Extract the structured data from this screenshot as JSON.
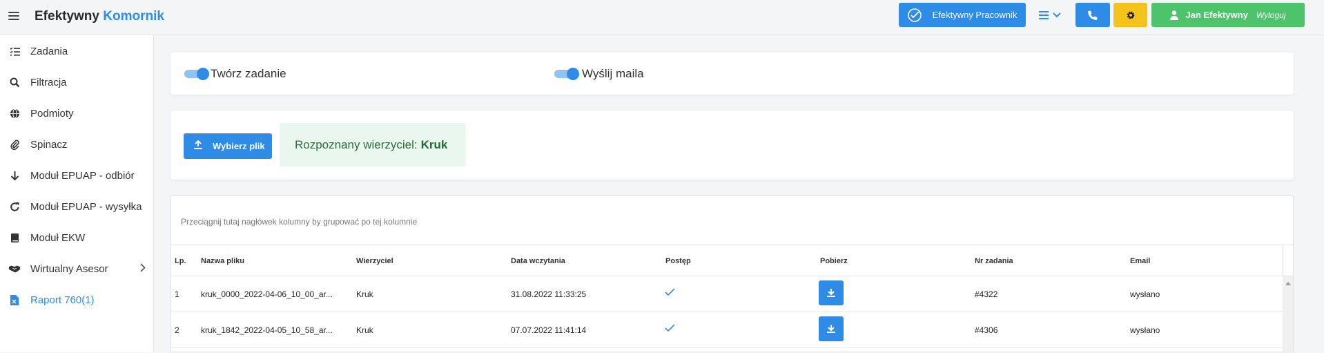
{
  "brand": {
    "part1": "Efektywny",
    "part2": "Komornik"
  },
  "topbar": {
    "pracownik_label": "Efektywny Pracownik",
    "user_name": "Jan Efektywny",
    "logout_label": "Wyloguj"
  },
  "sidebar": {
    "items": [
      {
        "label": "Zadania",
        "icon": "list-check-icon"
      },
      {
        "label": "Filtracja",
        "icon": "search-icon"
      },
      {
        "label": "Podmioty",
        "icon": "globe-icon"
      },
      {
        "label": "Spinacz",
        "icon": "paperclip-icon"
      },
      {
        "label": "Moduł EPUAP - odbiór",
        "icon": "arrow-down-icon"
      },
      {
        "label": "Moduł EPUAP - wysyłka",
        "icon": "redo-icon"
      },
      {
        "label": "Moduł EKW",
        "icon": "book-icon"
      },
      {
        "label": "Wirtualny Asesor",
        "icon": "handshake-icon"
      },
      {
        "label": "Raport 760(1)",
        "icon": "excel-file-icon"
      }
    ]
  },
  "options": {
    "create_task_label": "Twórz zadanie",
    "send_mail_label": "Wyślij maila"
  },
  "upload": {
    "button_label": "Wybierz plik",
    "recognized_prefix": "Rozpoznany wierzyciel:",
    "recognized_value": "Kruk"
  },
  "grid": {
    "group_hint": "Przeciągnij tutaj nagłówek kolumny by grupować po tej kolumnie",
    "columns": [
      "Lp.",
      "Nazwa pliku",
      "Wierzyciel",
      "Data wczytania",
      "Postęp",
      "Pobierz",
      "Nr zadania",
      "Email"
    ],
    "rows": [
      {
        "lp": "1",
        "file": "kruk_0000_2022-04-06_10_00_ar...",
        "creditor": "Kruk",
        "date": "31.08.2022 11:33:25",
        "task": "#4322",
        "email": "wysłano"
      },
      {
        "lp": "2",
        "file": "kruk_1842_2022-04-05_10_58_ar...",
        "creditor": "Kruk",
        "date": "07.07.2022 11:41:14",
        "task": "#4306",
        "email": "wysłano"
      }
    ]
  },
  "colors": {
    "primary": "#2e8ce6",
    "warning": "#f6c31c",
    "success": "#4dc36b"
  }
}
